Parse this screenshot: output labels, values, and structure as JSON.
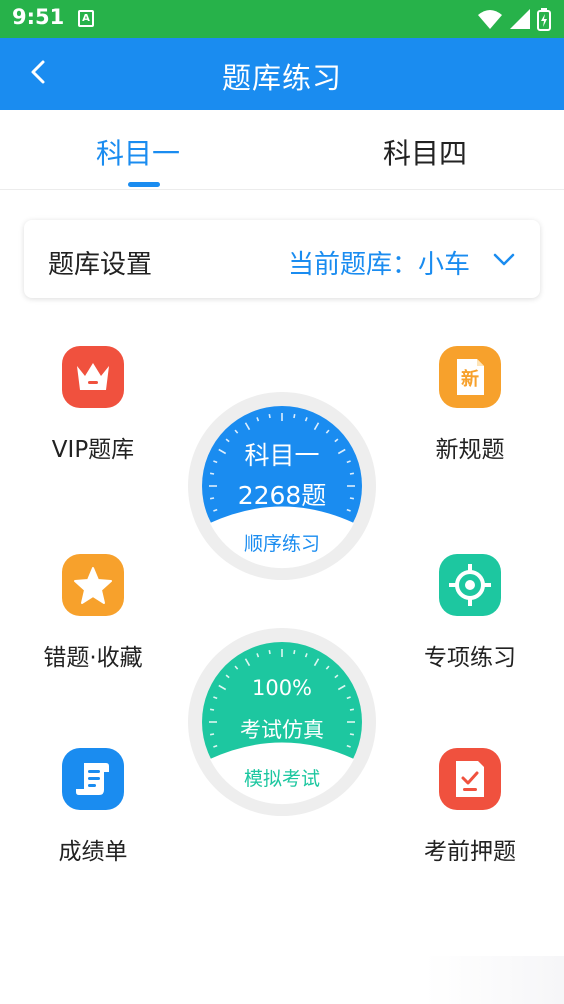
{
  "status_bar": {
    "time": "9:51",
    "notification_badge": "A",
    "icons": [
      "wifi-icon",
      "signal-icon",
      "battery-icon"
    ]
  },
  "app_bar": {
    "title": "题库练习",
    "back_icon": "chevron-left-icon"
  },
  "tabs": [
    {
      "label": "科目一",
      "active": true
    },
    {
      "label": "科目四",
      "active": false
    }
  ],
  "settings": {
    "label": "题库设置",
    "current_bank": "当前题库：小车",
    "chevron_icon": "chevron-down-icon"
  },
  "features": {
    "vip": {
      "label": "VIP题库",
      "icon": "crown-icon",
      "color": "#f0513e"
    },
    "new_rules": {
      "label": "新规题",
      "icon": "new-doc-icon",
      "icon_text": "新",
      "color": "#f7a12c"
    },
    "mistakes": {
      "label": "错题·收藏",
      "icon": "star-icon",
      "color": "#f7a12c"
    },
    "special": {
      "label": "专项练习",
      "icon": "target-icon",
      "color": "#1dc7a0"
    },
    "scores": {
      "label": "成绩单",
      "icon": "scroll-icon",
      "color": "#1a8cf0"
    },
    "pre_exam": {
      "label": "考前押题",
      "icon": "checklist-icon",
      "color": "#f0513e"
    }
  },
  "dials": {
    "sequential": {
      "line1": "科目一",
      "line2": "2268题",
      "bottom": "顺序练习",
      "color": "#1a8cf0"
    },
    "mock": {
      "line1": "100%",
      "line2": "考试仿真",
      "bottom": "模拟考试",
      "color": "#1dc7a0"
    }
  },
  "colors": {
    "primary": "#1a8cf0",
    "status_bar": "#27b24a",
    "teal": "#1dc7a0",
    "orange": "#f7a12c",
    "red": "#f0513e"
  }
}
